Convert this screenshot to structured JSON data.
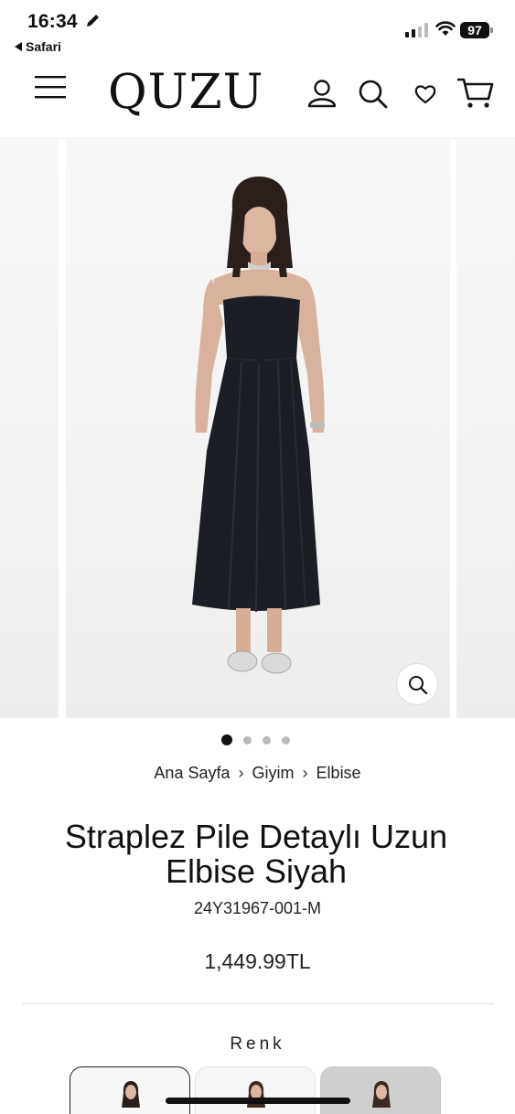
{
  "status_bar": {
    "time": "16:34",
    "back_app": "Safari",
    "battery": "97"
  },
  "header": {
    "logo": "QUZU",
    "icons": [
      "menu-icon",
      "user-icon",
      "search-icon",
      "heart-icon",
      "cart-icon"
    ]
  },
  "gallery": {
    "dots_count": 4,
    "active_dot": 0,
    "zoom_icon": "zoom-search-icon"
  },
  "breadcrumb": {
    "home": "Ana Sayfa",
    "sep": "›",
    "level1": "Giyim",
    "level2": "Elbise"
  },
  "product": {
    "title": "Straplez Pile Detaylı Uzun Elbise Siyah",
    "sku": "24Y31967-001-M",
    "price": "1,449.99TL"
  },
  "color_section": {
    "label": "Renk"
  },
  "colors": {
    "dress": "#1b1e24",
    "skin": "#d8b29c",
    "hair": "#2a1f1a",
    "accent": "#111111"
  }
}
